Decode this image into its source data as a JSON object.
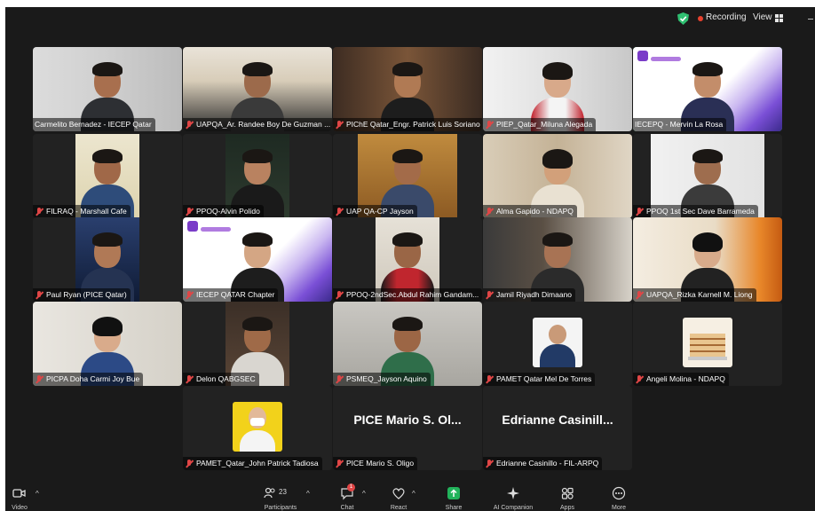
{
  "topbar": {
    "recording_label": "Recording",
    "view_label": "View",
    "icons": [
      "shield-icon",
      "recording-dot-icon",
      "grid-view-icon",
      "minimize-icon"
    ],
    "colors": {
      "shield": "#2fbf71",
      "recording": "#e8412e"
    }
  },
  "tiles": [
    {
      "name": "Carmelito Bernadez - IECEP Qatar",
      "muted": false
    },
    {
      "name": "UAPQA_Ar. Randee Boy De Guzman ...",
      "muted": true
    },
    {
      "name": "PIChE Qatar_Engr. Patrick Luis Soriano",
      "muted": true
    },
    {
      "name": "PIEP_Qatar_Miluna Alegada",
      "muted": true
    },
    {
      "name": "IECEPQ - Mervin La Rosa",
      "muted": false
    },
    {
      "name": "FILRAQ - Marshall Cafe",
      "muted": true
    },
    {
      "name": "PPOQ-Alvin Polido",
      "muted": true
    },
    {
      "name": "UAP QA-CP Jayson",
      "muted": true
    },
    {
      "name": "Alma Gapido - NDAPQ",
      "muted": true
    },
    {
      "name": "PPOQ 1st Sec Dave Barrameda",
      "muted": true
    },
    {
      "name": "Paul Ryan (PICE Qatar)",
      "muted": true
    },
    {
      "name": "IECEP QATAR Chapter",
      "muted": true
    },
    {
      "name": "PPOQ-2ndSec.Abdul Rahim Gandam...",
      "muted": true
    },
    {
      "name": "Jamil Riyadh Dimaano",
      "muted": true
    },
    {
      "name": "UAPQA_Rizka Karnell M. Liong",
      "muted": true
    },
    {
      "name": "PICPA Doha Carmi Joy Bue",
      "muted": true
    },
    {
      "name": "Delon QABGSEC",
      "muted": true
    },
    {
      "name": "PSMEQ_Jayson Aquino",
      "muted": true
    },
    {
      "name": "PAMET Qatar Mel De Torres",
      "muted": true
    },
    {
      "name": "Angeli Molina - NDAPQ",
      "muted": true
    },
    {
      "name": "PAMET_Qatar_John Patrick Tadiosa",
      "muted": true
    },
    {
      "name": "PICE Mario S. Oligo",
      "muted": true,
      "display": "PICE Mario S. Ol..."
    },
    {
      "name": "Edrianne Casinillo - FIL-ARPQ",
      "muted": true,
      "display": "Edrianne  Casinill..."
    }
  ],
  "toolbar": {
    "video_label": "Video",
    "participants_label": "Participants",
    "participants_count": "23",
    "chat_label": "Chat",
    "chat_badge": "1",
    "react_label": "React",
    "share_label": "Share",
    "ai_label": "AI Companion",
    "apps_label": "Apps",
    "more_label": "More",
    "colors": {
      "share": "#22b35b",
      "badge": "#e04646"
    }
  }
}
